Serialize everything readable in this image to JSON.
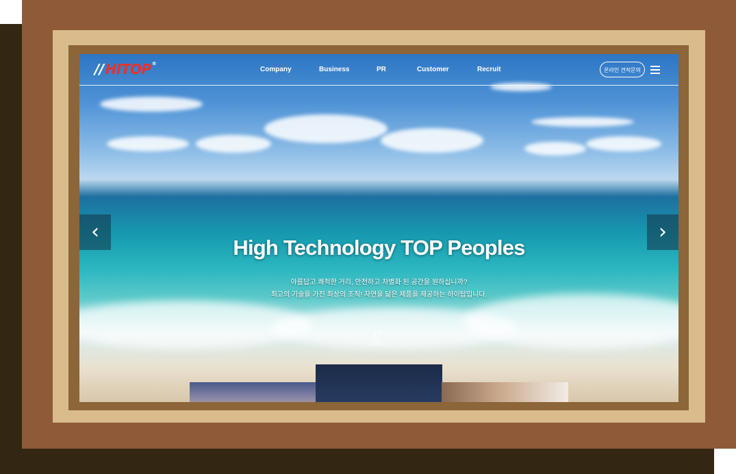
{
  "header": {
    "logo_text": "HITOP",
    "logo_mark": "//",
    "logo_reg": "®",
    "nav": [
      "Company",
      "Business",
      "PR",
      "Customer",
      "Recruit"
    ],
    "inquiry_button": "온라인 견적문의",
    "menu_icon": "hamburger-menu-icon"
  },
  "hero": {
    "title": "High Technology TOP Peoples",
    "subtitle_line1": "아름답고 쾌적한 거리, 안전하고 차별화 된 공간을 원하십니까?",
    "subtitle_line2": "최고의 기술을 가진 최상의 조직! 자연을 닮은 제품을 제공하는 하이탑입니다.",
    "prev_icon": "chevron-left-icon",
    "next_icon": "chevron-right-icon",
    "scroll_label": "SCROLL"
  },
  "colors": {
    "outer_frame": "#8f5a37",
    "shadow_frame": "#332613",
    "beige_frame": "#d9bb8c",
    "inner_frame": "#8c6538",
    "logo_red": "#e8312b"
  }
}
